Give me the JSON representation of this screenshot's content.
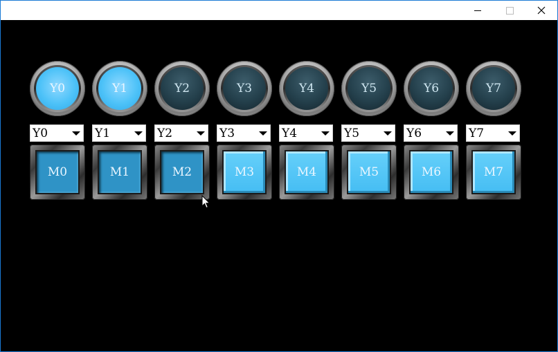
{
  "window": {
    "controls": {
      "minimize": "—",
      "maximize": "□",
      "close": "✕"
    }
  },
  "lamps": [
    {
      "label": "Y0",
      "state": "on"
    },
    {
      "label": "Y1",
      "state": "on"
    },
    {
      "label": "Y2",
      "state": "off"
    },
    {
      "label": "Y3",
      "state": "off"
    },
    {
      "label": "Y4",
      "state": "off"
    },
    {
      "label": "Y5",
      "state": "off"
    },
    {
      "label": "Y6",
      "state": "off"
    },
    {
      "label": "Y7",
      "state": "off"
    }
  ],
  "combos": [
    "Y0",
    "Y1",
    "Y2",
    "Y3",
    "Y4",
    "Y5",
    "Y6",
    "Y7"
  ],
  "buttons": [
    {
      "label": "M0",
      "state": "pressed"
    },
    {
      "label": "M1",
      "state": "pressed"
    },
    {
      "label": "M2",
      "state": "pressed"
    },
    {
      "label": "M3",
      "state": "raised"
    },
    {
      "label": "M4",
      "state": "raised"
    },
    {
      "label": "M5",
      "state": "raised"
    },
    {
      "label": "M6",
      "state": "raised"
    },
    {
      "label": "M7",
      "state": "raised"
    }
  ],
  "colors": {
    "lamp_on": "#4dc2f8",
    "lamp_off": "#24404c",
    "button_pressed": "#2f93c6",
    "button_raised": "#45bdf3"
  }
}
